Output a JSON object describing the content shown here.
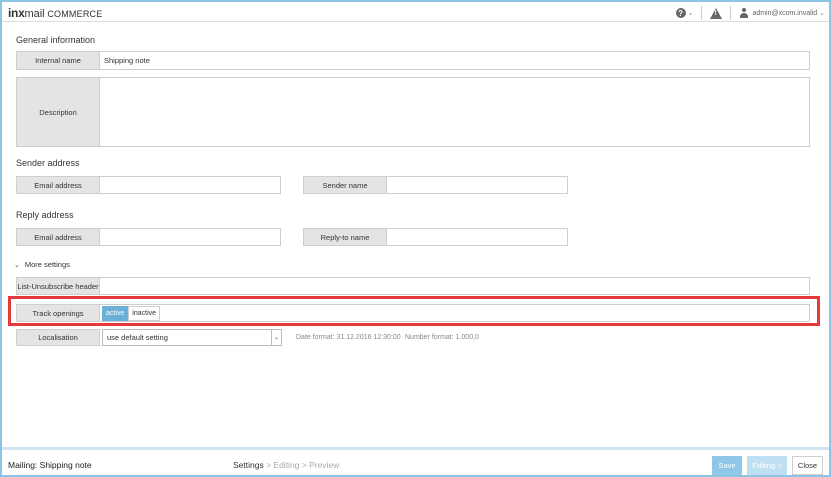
{
  "header": {
    "logo_bold": "inx",
    "logo_mid": "mail",
    "logo_product": " COMMERCE",
    "help_glyph": "?",
    "warning_glyph": "!",
    "user_email": "admin@xcom.invalid",
    "chevron": "⌄"
  },
  "general": {
    "title": "General information",
    "internal_name_label": "Internal name",
    "internal_name_value": "Shipping note",
    "description_label": "Description",
    "description_value": ""
  },
  "sender": {
    "title": "Sender address",
    "email_label": "Email address",
    "email_value": "",
    "name_label": "Sender name",
    "name_value": ""
  },
  "reply": {
    "title": "Reply address",
    "email_label": "Email address",
    "email_value": "",
    "name_label": "Reply-to name",
    "name_value": ""
  },
  "more": {
    "toggle_label": "More settings",
    "list_unsubscribe_label": "List-Unsubscribe header",
    "list_unsubscribe_value": "",
    "track_openings_label": "Track openings",
    "track_active": "active",
    "track_inactive": "inactive",
    "localisation_label": "Localisation",
    "localisation_value": "use default setting",
    "date_format": "Date format: 31.12.2016 12:30:00",
    "number_format": "Number format: 1.000,0"
  },
  "footer": {
    "title": "Mailing: Shipping note",
    "step_settings": "Settings",
    "step_editing": " > Editing > Preview",
    "save": "Save",
    "editing": "Editing >",
    "close": "Close"
  },
  "colors": {
    "accent": "#6ab0d8",
    "highlight": "#e5393b",
    "frame": "#8cc4e4"
  }
}
